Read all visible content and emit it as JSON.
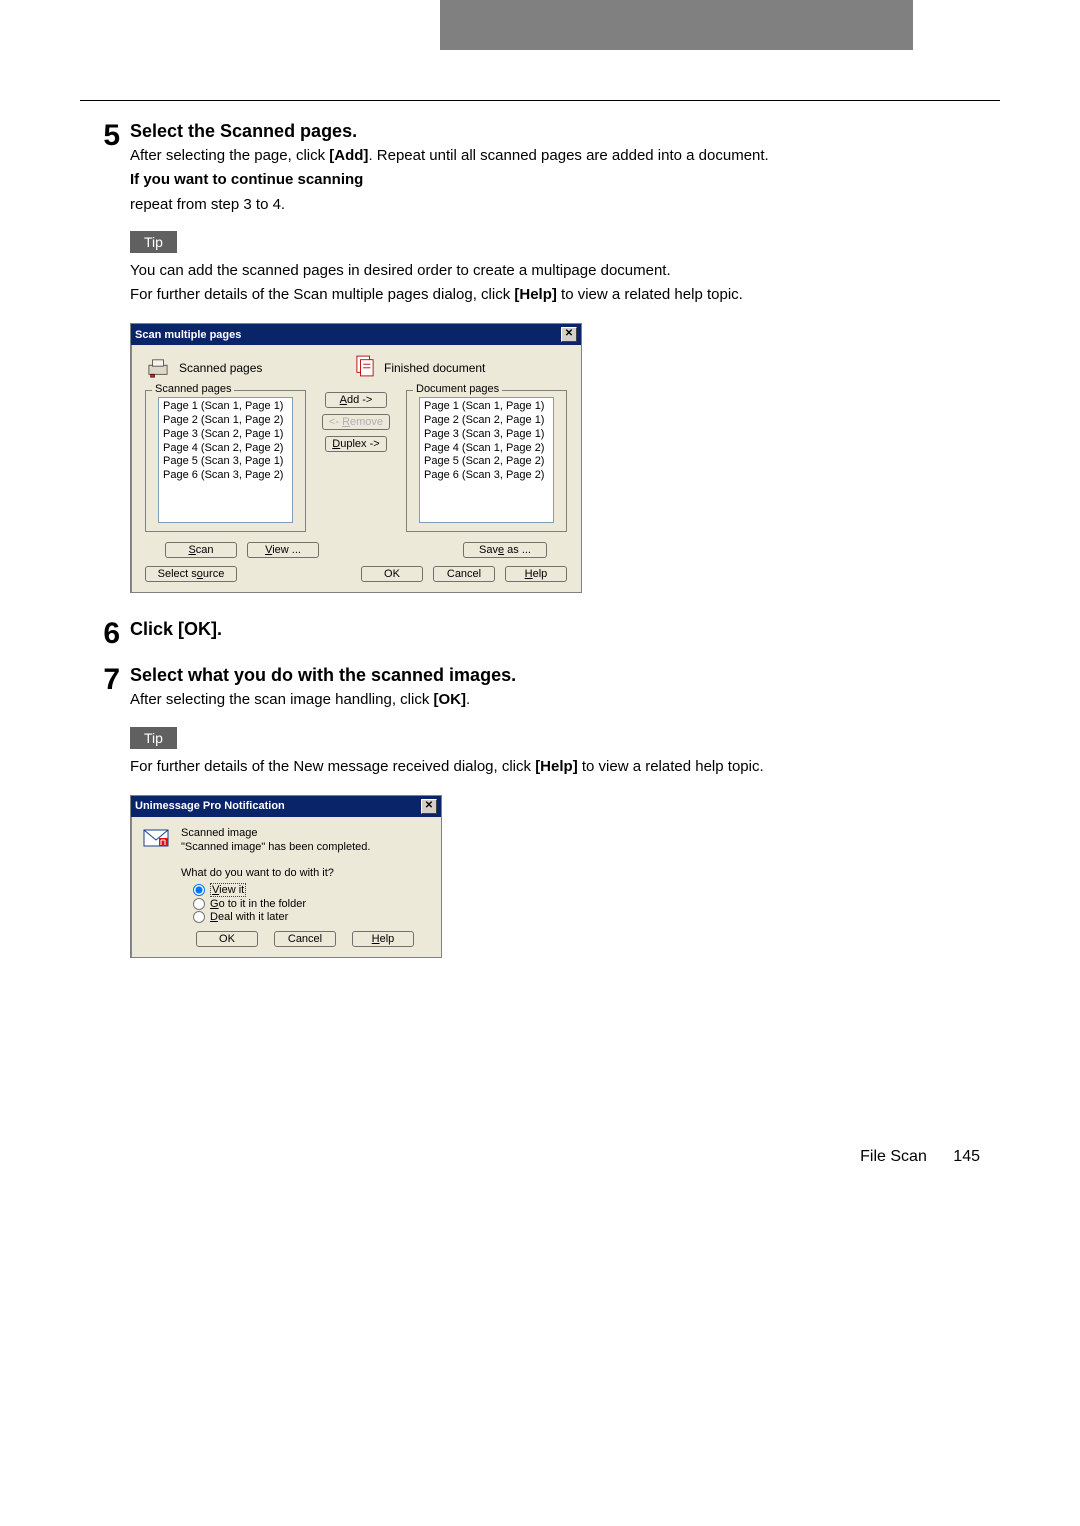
{
  "step5": {
    "num": "5",
    "title": "Select the Scanned pages.",
    "line1a": "After selecting the page, click ",
    "line1b": "[Add]",
    "line1c": ". Repeat until all scanned pages are added into a document.",
    "line2": "If you want to continue scanning",
    "line3": "repeat from step 3 to 4.",
    "tip_label": "Tip",
    "tip1": "You can add the scanned pages in desired order to create a multipage document.",
    "tip2a": "For further details of the Scan multiple pages dialog, click ",
    "tip2b": "[Help]",
    "tip2c": " to view a related help topic."
  },
  "dlg1": {
    "title": "Scan multiple pages",
    "left_header": "Scanned pages",
    "right_header": "Finished document",
    "left_group": "Scanned pages",
    "right_group": "Document pages",
    "left_items": [
      "Page 1 (Scan 1, Page 1)",
      "Page 2 (Scan 1, Page 2)",
      "Page 3 (Scan 2, Page 1)",
      "Page 4 (Scan 2, Page 2)",
      "Page 5 (Scan 3, Page 1)",
      "Page 6 (Scan 3, Page 2)"
    ],
    "right_items": [
      "Page 1 (Scan 1, Page 1)",
      "Page 2 (Scan 2, Page 1)",
      "Page 3 (Scan 3, Page 1)",
      "Page 4 (Scan 1, Page 2)",
      "Page 5 (Scan 2, Page 2)",
      "Page 6 (Scan 3, Page 2)"
    ],
    "btn_add": "Add ->",
    "btn_remove": "<- Remove",
    "btn_duplex": "Duplex ->",
    "btn_scan": "Scan",
    "btn_view": "View ...",
    "btn_saveas": "Save as ...",
    "btn_selectsrc": "Select source",
    "btn_ok": "OK",
    "btn_cancel": "Cancel",
    "btn_help": "Help"
  },
  "step6": {
    "num": "6",
    "title": "Click [OK]."
  },
  "step7": {
    "num": "7",
    "title": "Select what you do with the scanned images.",
    "line1a": "After selecting the scan image handling, click ",
    "line1b": "[OK]",
    "line1c": ".",
    "tip_label": "Tip",
    "tip1a": "For further details of the New message received dialog, click ",
    "tip1b": "[Help]",
    "tip1c": " to view a related help topic."
  },
  "dlg2": {
    "title": "Unimessage Pro Notification",
    "heading": "Scanned image",
    "msg": "\"Scanned image\" has been completed.",
    "prompt": "What do you want to do with it?",
    "opt_view": "View it",
    "opt_go": "Go to it in the folder",
    "opt_deal": "Deal with it later",
    "btn_ok": "OK",
    "btn_cancel": "Cancel",
    "btn_help": "Help"
  },
  "footer": {
    "section": "File Scan",
    "page": "145"
  }
}
